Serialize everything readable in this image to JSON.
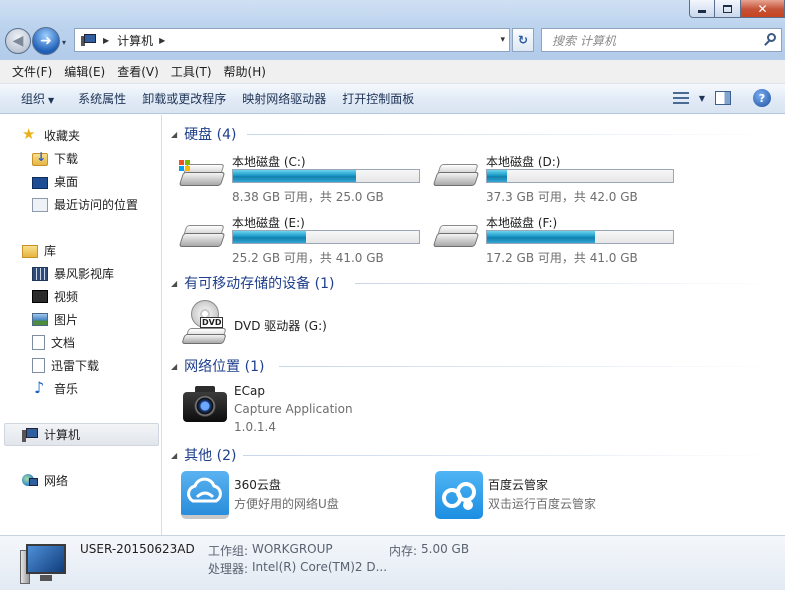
{
  "window": {
    "minimize_glyph": "",
    "maximize_glyph": "",
    "close_glyph": "✕"
  },
  "nav": {
    "back_glyph": "◀",
    "forward_glyph": "➜",
    "history_glyph": "▾"
  },
  "address": {
    "separator": "▶",
    "path": "计算机",
    "trailing_separator": "▶",
    "dropdown_glyph": "▾",
    "refresh_glyph": "↻"
  },
  "search": {
    "placeholder": "搜索 计算机"
  },
  "menubar": {
    "items": [
      "文件(F)",
      "编辑(E)",
      "查看(V)",
      "工具(T)",
      "帮助(H)"
    ]
  },
  "commandbar": {
    "organize": "组织",
    "organize_caret": "▼",
    "items": [
      "系统属性",
      "卸载或更改程序",
      "映射网络驱动器",
      "打开控制面板"
    ],
    "view_caret": "▼",
    "help_glyph": "?"
  },
  "sidebar": {
    "favorites": {
      "label": "收藏夹",
      "items": [
        "下载",
        "桌面",
        "最近访问的位置"
      ]
    },
    "libraries": {
      "label": "库",
      "items": [
        "暴风影视库",
        "视频",
        "图片",
        "文档",
        "迅雷下载",
        "音乐"
      ]
    },
    "computer": {
      "label": "计算机"
    },
    "network": {
      "label": "网络"
    }
  },
  "groups": {
    "harddisks": {
      "header": "硬盘 (4)",
      "collapse_glyph": "◢",
      "drives": [
        {
          "name": "本地磁盘 (C:)",
          "info": "8.38 GB 可用，共 25.0 GB",
          "used_fraction": 0.66
        },
        {
          "name": "本地磁盘 (D:)",
          "info": "37.3 GB 可用，共 42.0 GB",
          "used_fraction": 0.11
        },
        {
          "name": "本地磁盘 (E:)",
          "info": "25.2 GB 可用，共 41.0 GB",
          "used_fraction": 0.39
        },
        {
          "name": "本地磁盘 (F:)",
          "info": "17.2 GB 可用，共 41.0 GB",
          "used_fraction": 0.58
        }
      ]
    },
    "removable": {
      "header": "有可移动存储的设备 (1)",
      "collapse_glyph": "◢",
      "dvd": {
        "name": "DVD 驱动器 (G:)",
        "badge": "DVD"
      }
    },
    "network_locations": {
      "header": "网络位置 (1)",
      "collapse_glyph": "◢",
      "ecap": {
        "name": "ECap",
        "desc": "Capture Application",
        "version": "1.0.1.4"
      }
    },
    "other": {
      "header": "其他 (2)",
      "collapse_glyph": "◢",
      "items": [
        {
          "name": "360云盘",
          "desc": "方便好用的网络U盘"
        },
        {
          "name": "百度云管家",
          "desc": "双击运行百度云管家"
        }
      ]
    }
  },
  "details": {
    "computer_name": "USER-20150623AD",
    "workgroup_label": "工作组:",
    "workgroup": "WORKGROUP",
    "memory_label": "内存:",
    "memory": "5.00 GB",
    "processor_label": "处理器:",
    "processor": "Intel(R) Core(TM)2 D..."
  },
  "colors": {
    "header_text": "#1e3f8c",
    "bar_fill": "#1c9ac7",
    "frame": "#bcd3ee"
  }
}
